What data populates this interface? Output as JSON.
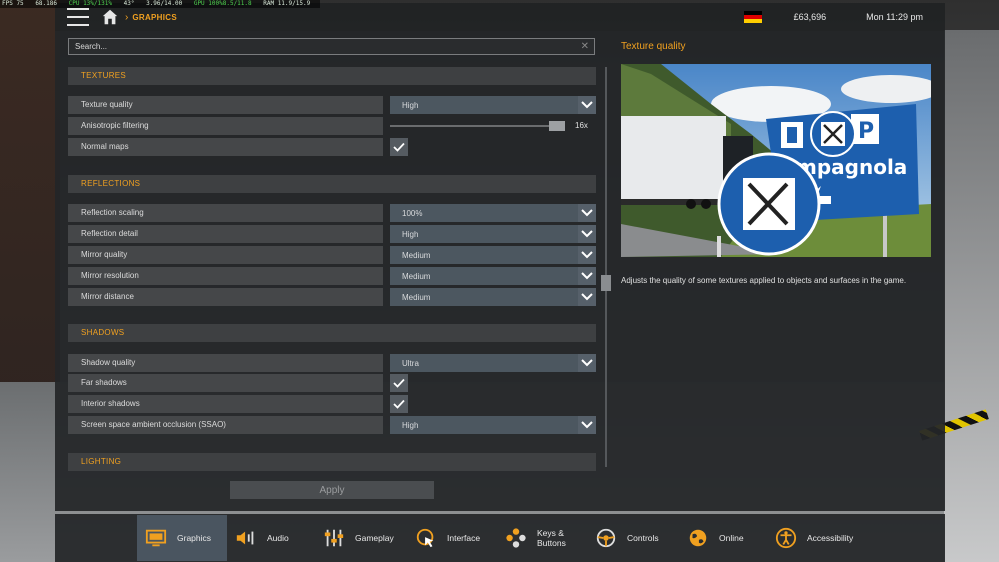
{
  "perf": {
    "fps": "FPS 75",
    "mem": "68.186",
    "cpu": "CPU 13%/131%",
    "temp": "43°",
    "cpu2": "3.96/14.00",
    "gpu": "GPU 100%8.5/11.8",
    "ram": "RAM 11.9/15.9"
  },
  "topbar": {
    "breadcrumb": "GRAPHICS",
    "money": "£63,696",
    "clock": "Mon 11:29 pm",
    "flag_colors": [
      "#000000",
      "#dd0000",
      "#ffce00"
    ]
  },
  "search": {
    "placeholder": "Search..."
  },
  "sections": {
    "textures": "TEXTURES",
    "reflections": "REFLECTIONS",
    "shadows": "SHADOWS",
    "lighting": "LIGHTING"
  },
  "settings": {
    "texture_quality": {
      "label": "Texture quality",
      "value": "High"
    },
    "anisotropic": {
      "label": "Anisotropic filtering",
      "value": "16x",
      "level": 1.0
    },
    "normal_maps": {
      "label": "Normal maps",
      "checked": true
    },
    "reflection_scaling": {
      "label": "Reflection scaling",
      "value": "100%"
    },
    "reflection_detail": {
      "label": "Reflection detail",
      "value": "High"
    },
    "mirror_quality": {
      "label": "Mirror quality",
      "value": "Medium"
    },
    "mirror_resolution": {
      "label": "Mirror resolution",
      "value": "Medium"
    },
    "mirror_distance": {
      "label": "Mirror distance",
      "value": "Medium"
    },
    "shadow_quality": {
      "label": "Shadow quality",
      "value": "Ultra"
    },
    "far_shadows": {
      "label": "Far shadows",
      "checked": true
    },
    "interior_shadows": {
      "label": "Interior shadows",
      "checked": true
    },
    "ssao": {
      "label": "Screen space ambient occlusion (SSAO)",
      "value": "High"
    }
  },
  "apply_label": "Apply",
  "info": {
    "title": "Texture quality",
    "description": "Adjusts the quality of some textures applied to objects and surfaces in the game.",
    "sign_text": "mpagnola"
  },
  "nav": {
    "graphics": "Graphics",
    "audio": "Audio",
    "gameplay": "Gameplay",
    "interface": "Interface",
    "keys_line1": "Keys &",
    "keys_line2": "Buttons",
    "controls": "Controls",
    "online": "Online",
    "accessibility": "Accessibility"
  },
  "colors": {
    "accent": "#f0a020",
    "active_tab": "#4a5560"
  }
}
